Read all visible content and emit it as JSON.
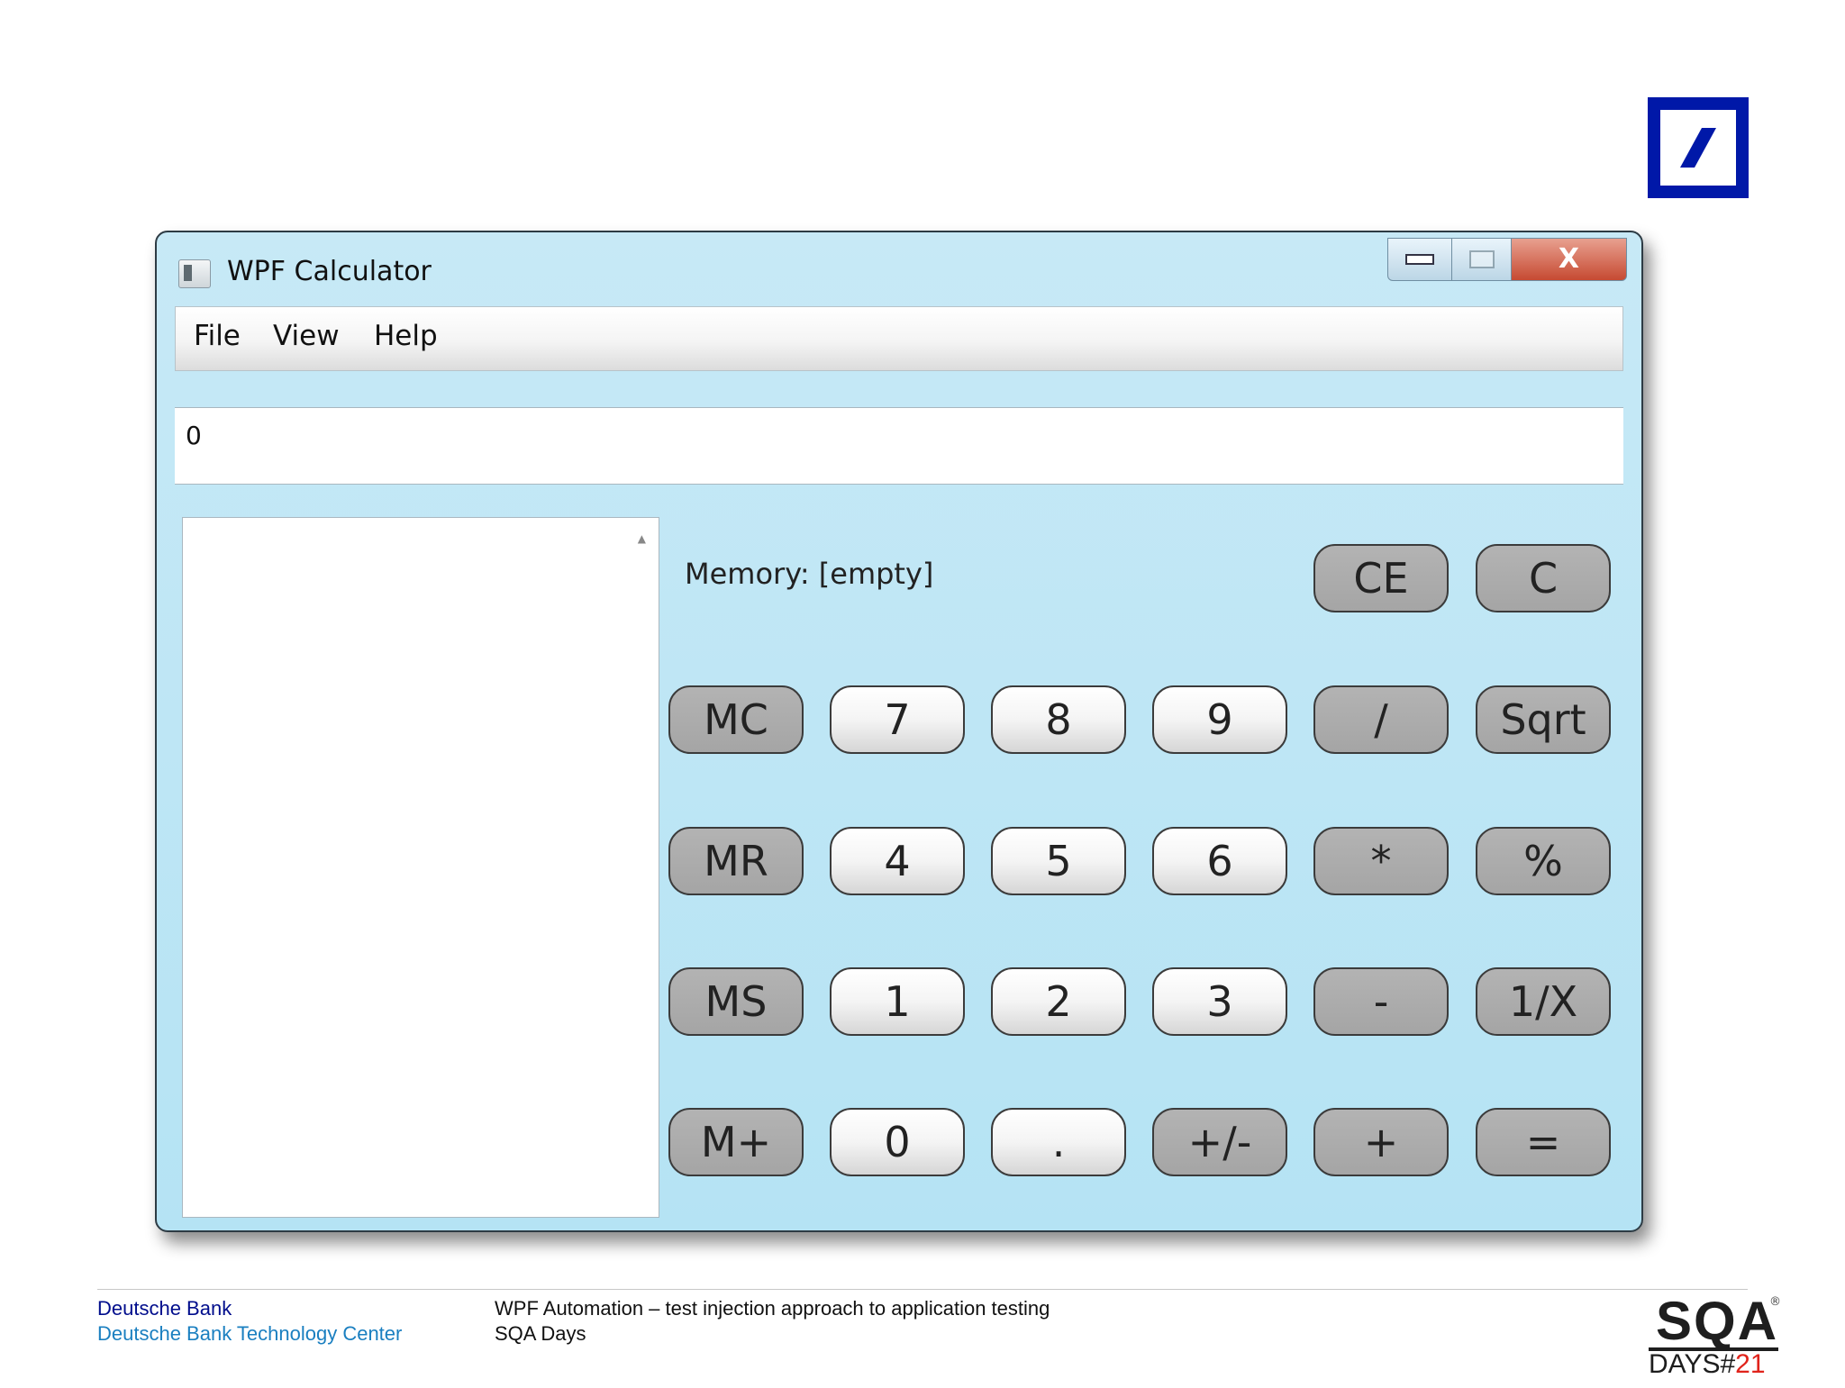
{
  "window": {
    "title": "WPF Calculator",
    "close_glyph": "X"
  },
  "menu": [
    "File",
    "View",
    "Help"
  ],
  "display": {
    "value": "0"
  },
  "memory": {
    "label": "Memory: [empty]"
  },
  "buttons": {
    "ce": "CE",
    "c": "C",
    "mc": "MC",
    "mr": "MR",
    "ms": "MS",
    "mplus": "M+",
    "d7": "7",
    "d8": "8",
    "d9": "9",
    "d4": "4",
    "d5": "5",
    "d6": "6",
    "d1": "1",
    "d2": "2",
    "d3": "3",
    "d0": "0",
    "dot": ".",
    "neg": "+/-",
    "div": "/",
    "mul": "*",
    "sub": "-",
    "add": "+",
    "sqrt": "Sqrt",
    "pct": "%",
    "recip": "1/X",
    "eq": "="
  },
  "footer": {
    "company": "Deutsche Bank",
    "center": "Deutsche Bank Technology Center",
    "talk_title": "WPF Automation – test injection approach to application testing",
    "event": "SQA Days"
  },
  "sqa_logo": {
    "top": "SQA",
    "days": "DAYS",
    "hash": "#",
    "number": "21",
    "reg": "®"
  },
  "colors": {
    "db_blue": "#0018a8",
    "window_bg": "#b5e3f4",
    "gray_button": "#a8a8a8",
    "footer_dark_blue": "#000d8c",
    "footer_light_blue": "#1a7fc0",
    "sqa_red": "#e0231b"
  },
  "icons": [
    "deutsche-bank-logo",
    "app-icon",
    "minimize-icon",
    "maximize-icon",
    "close-icon"
  ]
}
